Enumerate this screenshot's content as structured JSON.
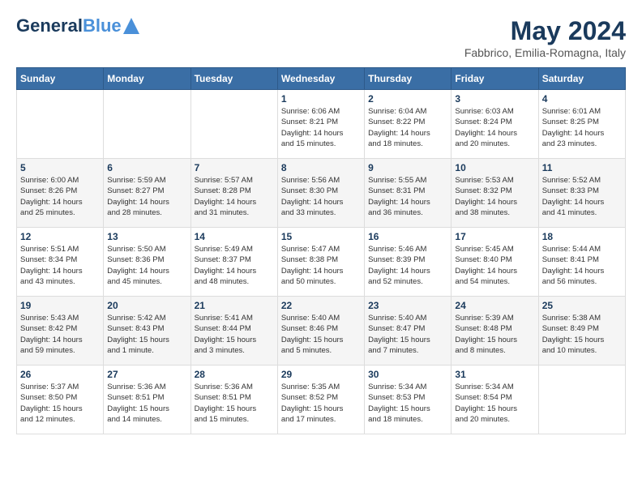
{
  "header": {
    "logo_line1": "General",
    "logo_line2": "Blue",
    "month_title": "May 2024",
    "subtitle": "Fabbrico, Emilia-Romagna, Italy"
  },
  "days_of_week": [
    "Sunday",
    "Monday",
    "Tuesday",
    "Wednesday",
    "Thursday",
    "Friday",
    "Saturday"
  ],
  "weeks": [
    [
      {
        "day": "",
        "info": ""
      },
      {
        "day": "",
        "info": ""
      },
      {
        "day": "",
        "info": ""
      },
      {
        "day": "1",
        "info": "Sunrise: 6:06 AM\nSunset: 8:21 PM\nDaylight: 14 hours\nand 15 minutes."
      },
      {
        "day": "2",
        "info": "Sunrise: 6:04 AM\nSunset: 8:22 PM\nDaylight: 14 hours\nand 18 minutes."
      },
      {
        "day": "3",
        "info": "Sunrise: 6:03 AM\nSunset: 8:24 PM\nDaylight: 14 hours\nand 20 minutes."
      },
      {
        "day": "4",
        "info": "Sunrise: 6:01 AM\nSunset: 8:25 PM\nDaylight: 14 hours\nand 23 minutes."
      }
    ],
    [
      {
        "day": "5",
        "info": "Sunrise: 6:00 AM\nSunset: 8:26 PM\nDaylight: 14 hours\nand 25 minutes."
      },
      {
        "day": "6",
        "info": "Sunrise: 5:59 AM\nSunset: 8:27 PM\nDaylight: 14 hours\nand 28 minutes."
      },
      {
        "day": "7",
        "info": "Sunrise: 5:57 AM\nSunset: 8:28 PM\nDaylight: 14 hours\nand 31 minutes."
      },
      {
        "day": "8",
        "info": "Sunrise: 5:56 AM\nSunset: 8:30 PM\nDaylight: 14 hours\nand 33 minutes."
      },
      {
        "day": "9",
        "info": "Sunrise: 5:55 AM\nSunset: 8:31 PM\nDaylight: 14 hours\nand 36 minutes."
      },
      {
        "day": "10",
        "info": "Sunrise: 5:53 AM\nSunset: 8:32 PM\nDaylight: 14 hours\nand 38 minutes."
      },
      {
        "day": "11",
        "info": "Sunrise: 5:52 AM\nSunset: 8:33 PM\nDaylight: 14 hours\nand 41 minutes."
      }
    ],
    [
      {
        "day": "12",
        "info": "Sunrise: 5:51 AM\nSunset: 8:34 PM\nDaylight: 14 hours\nand 43 minutes."
      },
      {
        "day": "13",
        "info": "Sunrise: 5:50 AM\nSunset: 8:36 PM\nDaylight: 14 hours\nand 45 minutes."
      },
      {
        "day": "14",
        "info": "Sunrise: 5:49 AM\nSunset: 8:37 PM\nDaylight: 14 hours\nand 48 minutes."
      },
      {
        "day": "15",
        "info": "Sunrise: 5:47 AM\nSunset: 8:38 PM\nDaylight: 14 hours\nand 50 minutes."
      },
      {
        "day": "16",
        "info": "Sunrise: 5:46 AM\nSunset: 8:39 PM\nDaylight: 14 hours\nand 52 minutes."
      },
      {
        "day": "17",
        "info": "Sunrise: 5:45 AM\nSunset: 8:40 PM\nDaylight: 14 hours\nand 54 minutes."
      },
      {
        "day": "18",
        "info": "Sunrise: 5:44 AM\nSunset: 8:41 PM\nDaylight: 14 hours\nand 56 minutes."
      }
    ],
    [
      {
        "day": "19",
        "info": "Sunrise: 5:43 AM\nSunset: 8:42 PM\nDaylight: 14 hours\nand 59 minutes."
      },
      {
        "day": "20",
        "info": "Sunrise: 5:42 AM\nSunset: 8:43 PM\nDaylight: 15 hours\nand 1 minute."
      },
      {
        "day": "21",
        "info": "Sunrise: 5:41 AM\nSunset: 8:44 PM\nDaylight: 15 hours\nand 3 minutes."
      },
      {
        "day": "22",
        "info": "Sunrise: 5:40 AM\nSunset: 8:46 PM\nDaylight: 15 hours\nand 5 minutes."
      },
      {
        "day": "23",
        "info": "Sunrise: 5:40 AM\nSunset: 8:47 PM\nDaylight: 15 hours\nand 7 minutes."
      },
      {
        "day": "24",
        "info": "Sunrise: 5:39 AM\nSunset: 8:48 PM\nDaylight: 15 hours\nand 8 minutes."
      },
      {
        "day": "25",
        "info": "Sunrise: 5:38 AM\nSunset: 8:49 PM\nDaylight: 15 hours\nand 10 minutes."
      }
    ],
    [
      {
        "day": "26",
        "info": "Sunrise: 5:37 AM\nSunset: 8:50 PM\nDaylight: 15 hours\nand 12 minutes."
      },
      {
        "day": "27",
        "info": "Sunrise: 5:36 AM\nSunset: 8:51 PM\nDaylight: 15 hours\nand 14 minutes."
      },
      {
        "day": "28",
        "info": "Sunrise: 5:36 AM\nSunset: 8:51 PM\nDaylight: 15 hours\nand 15 minutes."
      },
      {
        "day": "29",
        "info": "Sunrise: 5:35 AM\nSunset: 8:52 PM\nDaylight: 15 hours\nand 17 minutes."
      },
      {
        "day": "30",
        "info": "Sunrise: 5:34 AM\nSunset: 8:53 PM\nDaylight: 15 hours\nand 18 minutes."
      },
      {
        "day": "31",
        "info": "Sunrise: 5:34 AM\nSunset: 8:54 PM\nDaylight: 15 hours\nand 20 minutes."
      },
      {
        "day": "",
        "info": ""
      }
    ]
  ]
}
